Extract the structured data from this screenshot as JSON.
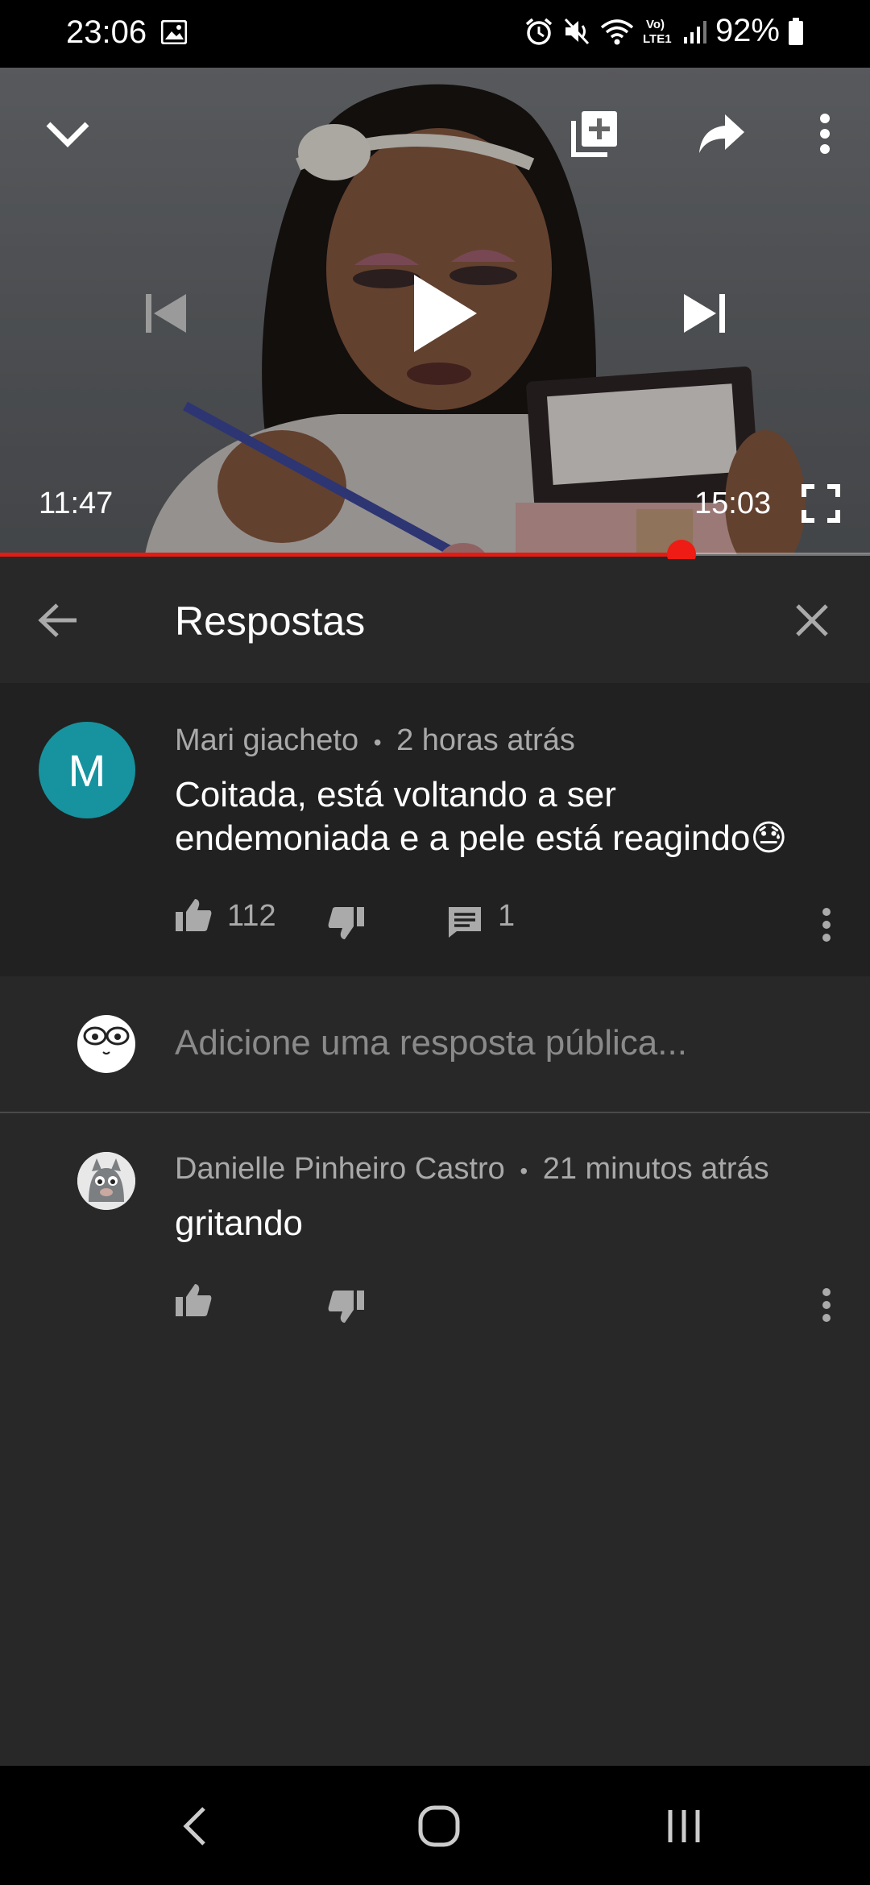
{
  "status_bar": {
    "time": "23:06",
    "battery": "92%",
    "icons": [
      "image-icon",
      "alarm-icon",
      "mute-icon",
      "wifi-icon",
      "volte-icon",
      "signal-icon",
      "battery-icon"
    ],
    "volte_label": "Vo)\nLTE1"
  },
  "player": {
    "current_time": "11:47",
    "total_time": "15:03",
    "progress_fraction": 0.783,
    "accent": "#e41b13",
    "icons": [
      "collapse-chevron-icon",
      "add-to-playlist-icon",
      "share-icon",
      "more-vert-icon",
      "previous-icon",
      "play-icon",
      "next-icon",
      "fullscreen-icon"
    ]
  },
  "replies_panel": {
    "title": "Respostas",
    "back_icon": "arrow-back-icon",
    "close_icon": "close-icon"
  },
  "main_comment": {
    "avatar_letter": "M",
    "avatar_color": "#16939e",
    "author": "Mari giacheto",
    "separator": "•",
    "time": "2 horas atrás",
    "text_line1": "Coitada, está voltando a ser",
    "text_line2": "endemoniada e a pele está reagindo😓",
    "likes": "112",
    "replies": "1"
  },
  "reply_input": {
    "placeholder": "Adicione uma resposta pública..."
  },
  "replies": [
    {
      "author": "Danielle Pinheiro Castro",
      "separator": "•",
      "time": "21 minutos atrás",
      "text": "gritando"
    }
  ],
  "nav_bar": {
    "icons": [
      "nav-back-icon",
      "nav-home-icon",
      "nav-recents-icon"
    ]
  }
}
